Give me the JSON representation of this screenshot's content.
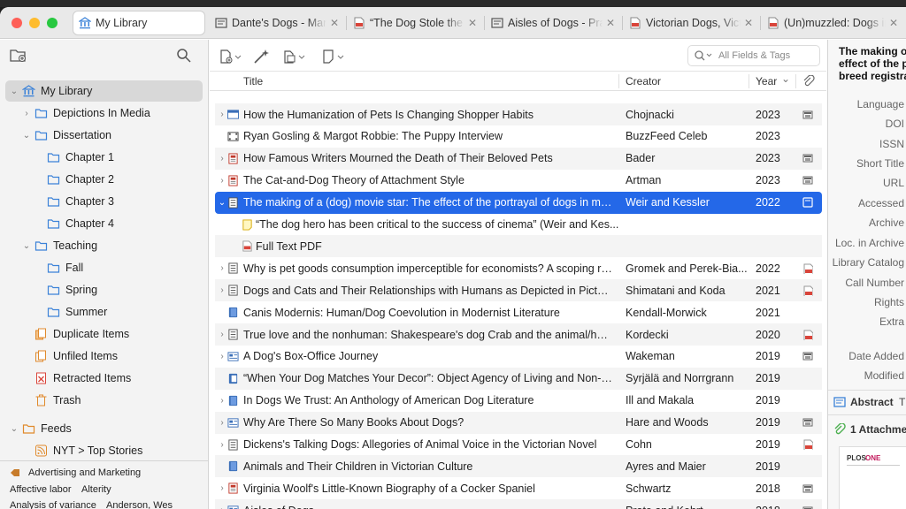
{
  "tabs": [
    {
      "label": "My Library",
      "icon": "library-icon"
    },
    {
      "label": "Dante's Dogs - Manu",
      "icon": "document-icon"
    },
    {
      "label": "“The Dog Stole the Show”",
      "icon": "pdf-icon"
    },
    {
      "label": "Aisles of Dogs - Prato",
      "icon": "document-icon"
    },
    {
      "label": "Victorian Dogs, Victorian",
      "icon": "pdf-icon"
    },
    {
      "label": "(Un)muzzled: Dogs in",
      "icon": "pdf-icon"
    }
  ],
  "tab_close": "✕",
  "sidebar": {
    "items": [
      {
        "label": "My Library",
        "icon": "library-icon",
        "chevron": "⌄"
      },
      {
        "label": "Depictions In Media",
        "icon": "folder-icon",
        "chevron": "›"
      },
      {
        "label": "Dissertation",
        "icon": "folder-icon",
        "chevron": "⌄"
      },
      {
        "label": "Chapter 1",
        "icon": "folder-icon",
        "chevron": ""
      },
      {
        "label": "Chapter 2",
        "icon": "folder-icon",
        "chevron": ""
      },
      {
        "label": "Chapter 3",
        "icon": "folder-icon",
        "chevron": ""
      },
      {
        "label": "Chapter 4",
        "icon": "folder-icon",
        "chevron": ""
      },
      {
        "label": "Teaching",
        "icon": "folder-icon",
        "chevron": "⌄"
      },
      {
        "label": "Fall",
        "icon": "folder-icon",
        "chevron": ""
      },
      {
        "label": "Spring",
        "icon": "folder-icon",
        "chevron": ""
      },
      {
        "label": "Summer",
        "icon": "folder-icon",
        "chevron": ""
      },
      {
        "label": "Duplicate Items",
        "icon": "duplicate-icon",
        "chevron": ""
      },
      {
        "label": "Unfiled Items",
        "icon": "unfiled-icon",
        "chevron": ""
      },
      {
        "label": "Retracted Items",
        "icon": "retracted-icon",
        "chevron": ""
      },
      {
        "label": "Trash",
        "icon": "trash-icon",
        "chevron": ""
      },
      {
        "label": "Feeds",
        "icon": "feeds-icon",
        "chevron": "⌄"
      },
      {
        "label": "NYT > Top Stories",
        "icon": "rss-icon",
        "chevron": ""
      }
    ],
    "tags": [
      "Advertising and Marketing",
      "Affective labor",
      "Alterity",
      "Analysis of variance",
      "Anderson, Wes"
    ]
  },
  "columns": {
    "title": "Title",
    "creator": "Creator",
    "year": "Year",
    "year_sort": "⌄"
  },
  "search": {
    "placeholder": "All Fields & Tags"
  },
  "items": [
    {
      "title": "How the Humanization of Pets Is Changing Shopper Habits",
      "creator": "Chojnacki",
      "year": "2023",
      "chevron": "›",
      "icon": "webpage-icon",
      "att": "snapshot-icon"
    },
    {
      "title": "Ryan Gosling & Margot Robbie: The Puppy Interview",
      "creator": "BuzzFeed Celeb",
      "year": "2023",
      "chevron": "",
      "icon": "video-icon",
      "att": ""
    },
    {
      "title": "How Famous Writers Mourned the Death of Their Beloved Pets",
      "creator": "Bader",
      "year": "2023",
      "chevron": "›",
      "icon": "magazine-icon",
      "att": "snapshot-icon"
    },
    {
      "title": "The Cat-and-Dog Theory of Attachment Style",
      "creator": "Artman",
      "year": "2023",
      "chevron": "›",
      "icon": "magazine-icon",
      "att": "snapshot-icon"
    },
    {
      "title": "The making of a (dog) movie star: The effect of the portrayal of dogs in mo...",
      "creator": "Weir and Kessler",
      "year": "2022",
      "chevron": "⌄",
      "icon": "article-icon",
      "att": "attachment-icon",
      "selected": true
    },
    {
      "title": "“The dog hero has been critical to the success of cinema” (Weir and Kes...",
      "creator": "",
      "year": "",
      "chevron": "",
      "icon": "note-icon",
      "att": "",
      "child": true
    },
    {
      "title": "Full Text PDF",
      "creator": "",
      "year": "",
      "chevron": "",
      "icon": "pdf-icon",
      "att": "",
      "child": true
    },
    {
      "title": "Why is pet goods consumption imperceptible for economists? A scoping re...",
      "creator": "Gromek and Perek-Bia...",
      "year": "2022",
      "chevron": "›",
      "icon": "article-icon",
      "att": "pdf-icon"
    },
    {
      "title": "Dogs and Cats and Their Relationships with Humans as Depicted in Picture ...",
      "creator": "Shimatani and Koda",
      "year": "2021",
      "chevron": "›",
      "icon": "article-icon",
      "att": "pdf-icon"
    },
    {
      "title": "Canis Modernis: Human/Dog Coevolution in Modernist Literature",
      "creator": "Kendall-Morwick",
      "year": "2021",
      "chevron": "",
      "icon": "book-icon",
      "att": ""
    },
    {
      "title": "True love and the nonhuman: Shakespeare's dog Crab and the animal/huma...",
      "creator": "Kordecki",
      "year": "2020",
      "chevron": "›",
      "icon": "article-icon",
      "att": "pdf-icon"
    },
    {
      "title": "A Dog's Box-Office Journey",
      "creator": "Wakeman",
      "year": "2019",
      "chevron": "›",
      "icon": "newspaper-icon",
      "att": "snapshot-icon"
    },
    {
      "title": "“When Your Dog Matches Your Decor”: Object Agency of Living and Non-Li...",
      "creator": "Syrjälä and Norrgrann",
      "year": "2019",
      "chevron": "",
      "icon": "book-section-icon",
      "att": ""
    },
    {
      "title": "In Dogs We Trust: An Anthology of American Dog Literature",
      "creator": "Ill and Makala",
      "year": "2019",
      "chevron": "›",
      "icon": "book-icon",
      "att": ""
    },
    {
      "title": "Why Are There So Many Books About Dogs?",
      "creator": "Hare and Woods",
      "year": "2019",
      "chevron": "›",
      "icon": "newspaper-icon",
      "att": "snapshot-icon"
    },
    {
      "title": "Dickens's Talking Dogs: Allegories of Animal Voice in the Victorian Novel",
      "creator": "Cohn",
      "year": "2019",
      "chevron": "›",
      "icon": "article-icon",
      "att": "pdf-icon"
    },
    {
      "title": "Animals and Their Children in Victorian Culture",
      "creator": "Ayres and Maier",
      "year": "2019",
      "chevron": "",
      "icon": "book-icon",
      "att": ""
    },
    {
      "title": "Virginia Woolf's Little-Known Biography of a Cocker Spaniel",
      "creator": "Schwartz",
      "year": "2018",
      "chevron": "›",
      "icon": "magazine-icon",
      "att": "snapshot-icon"
    },
    {
      "title": "Aisles of Dogs",
      "creator": "Prato and Kehrt",
      "year": "2018",
      "chevron": "›",
      "icon": "newspaper-icon",
      "att": "snapshot-icon"
    }
  ],
  "right_pane": {
    "header_line1": "The making of a (dog)",
    "header_line2": "effect of the portrayal",
    "header_line3": "breed registrations",
    "fields": [
      "Language",
      "DOI",
      "ISSN",
      "Short Title",
      "URL",
      "Accessed",
      "Archive",
      "Loc. in Archive",
      "Library Catalog",
      "Call Number",
      "Rights",
      "Extra",
      "Date Added",
      "Modified"
    ],
    "abstract": "Abstract",
    "abstract_tail": "T",
    "attachments": "1 Attachment",
    "thumb_brand1": "PLOS",
    "thumb_brand2": "ONE"
  },
  "colors": {
    "accent": "#2468e8",
    "folder": "#3b82d8",
    "pdf_red": "#d9453b"
  }
}
